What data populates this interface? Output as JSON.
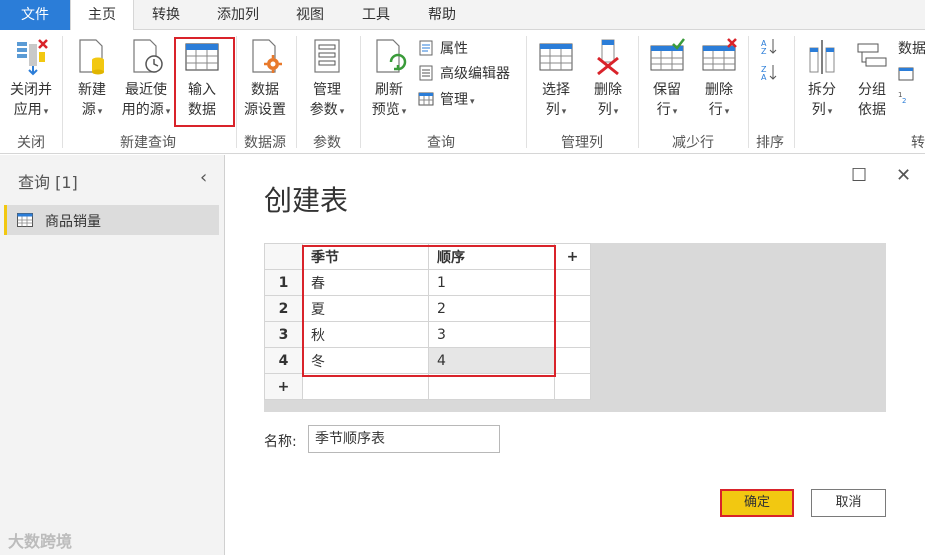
{
  "menu": {
    "tabs": [
      "文件",
      "主页",
      "转换",
      "添加列",
      "视图",
      "工具",
      "帮助"
    ]
  },
  "ribbon": {
    "close_apply": {
      "line1": "关闭并",
      "line2": "应用"
    },
    "new_source": {
      "line1": "新建",
      "line2": "源"
    },
    "recent_sources": {
      "line1": "最近使",
      "line2": "用的源"
    },
    "enter_data": {
      "line1": "输入",
      "line2": "数据"
    },
    "source_settings": {
      "line1": "数据",
      "line2": "源设置"
    },
    "manage_params": {
      "line1": "管理",
      "line2": "参数"
    },
    "refresh_preview": {
      "line1": "刷新",
      "line2": "预览"
    },
    "properties": "属性",
    "advanced_editor": "高级编辑器",
    "manage": "管理",
    "choose_columns": {
      "line1": "选择",
      "line2": "列"
    },
    "remove_columns": {
      "line1": "删除",
      "line2": "列"
    },
    "keep_rows": {
      "line1": "保留",
      "line2": "行"
    },
    "remove_rows": {
      "line1": "删除",
      "line2": "行"
    },
    "split_column": {
      "line1": "拆分",
      "line2": "列"
    },
    "group_by": {
      "line1": "分组",
      "line2": "依据"
    },
    "datatype_cut": "数据",
    "transform_cut": "转",
    "groups": {
      "close": "关闭",
      "new_query": "新建查询",
      "data_source": "数据源",
      "parameters": "参数",
      "query": "查询",
      "manage_columns": "管理列",
      "reduce_rows": "减少行",
      "sort": "排序"
    }
  },
  "queries_pane": {
    "title": "查询 [1]",
    "items": [
      "商品销量"
    ]
  },
  "dialog": {
    "title": "创建表",
    "columns": [
      "季节",
      "顺序"
    ],
    "add_col": "+",
    "rows": [
      {
        "num": "1",
        "season": "春",
        "order": "1"
      },
      {
        "num": "2",
        "season": "夏",
        "order": "2"
      },
      {
        "num": "3",
        "season": "秋",
        "order": "3"
      },
      {
        "num": "4",
        "season": "冬",
        "order": "4"
      }
    ],
    "add_row": "+",
    "name_label": "名称:",
    "name_value": "季节顺序表",
    "ok": "确定",
    "cancel": "取消"
  },
  "colors": {
    "accent_blue": "#2b7dd8",
    "highlight_red": "#d9232a",
    "ok_yellow": "#f2c811"
  },
  "watermark": "大数跨境"
}
